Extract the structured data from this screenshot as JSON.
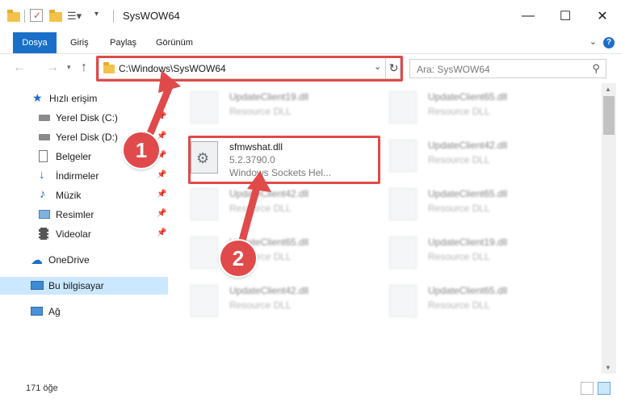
{
  "window": {
    "title": "SysWOW64",
    "minimize": "—",
    "maximize": "☐",
    "close": "✕"
  },
  "ribbon": {
    "tabs": [
      {
        "label": "Dosya"
      },
      {
        "label": "Giriş"
      },
      {
        "label": "Paylaş"
      },
      {
        "label": "Görünüm"
      }
    ],
    "help": "?"
  },
  "nav": {
    "address": "C:\\Windows\\SysWOW64",
    "search_placeholder": "Ara: SysWOW64"
  },
  "sidebar": {
    "items": [
      {
        "label": "Hızlı erişim"
      },
      {
        "label": "Yerel Disk (C:)"
      },
      {
        "label": "Yerel Disk (D:)"
      },
      {
        "label": "Belgeler"
      },
      {
        "label": "İndirmeler"
      },
      {
        "label": "Müzik"
      },
      {
        "label": "Resimler"
      },
      {
        "label": "Videolar"
      },
      {
        "label": "OneDrive"
      },
      {
        "label": "Bu bilgisayar"
      },
      {
        "label": "Ağ"
      }
    ]
  },
  "files": {
    "highlighted": {
      "name": "sfmwshat.dll",
      "version": "5.2.3790.0",
      "description": "Windows Sockets Hel..."
    },
    "others": [
      {
        "name": "UpdateClient19.dll",
        "type": "Resource DLL"
      },
      {
        "name": "UpdateClient65.dll",
        "type": "Resource DLL"
      },
      {
        "name": "UpdateClient42.dll",
        "type": "Resource DLL"
      },
      {
        "name": "UpdateClient65.dll",
        "type": "Resource DLL"
      },
      {
        "name": "UpdateClient65.dll",
        "type": "Resource DLL"
      },
      {
        "name": "UpdateClient65.dll",
        "type": "Resource DLL"
      },
      {
        "name": "UpdateClient19.dll",
        "type": "Resource DLL"
      },
      {
        "name": "UpdateClient42.dll",
        "type": "Resource DLL"
      },
      {
        "name": "UpdateClient65.dll",
        "type": "Resource DLL"
      }
    ]
  },
  "status": {
    "count": "171 öğe"
  },
  "callouts": {
    "one": "1",
    "two": "2"
  },
  "colors": {
    "accent": "#1a6fc9",
    "callout_red": "#e04a4a",
    "selected_bg": "#cce8ff"
  }
}
